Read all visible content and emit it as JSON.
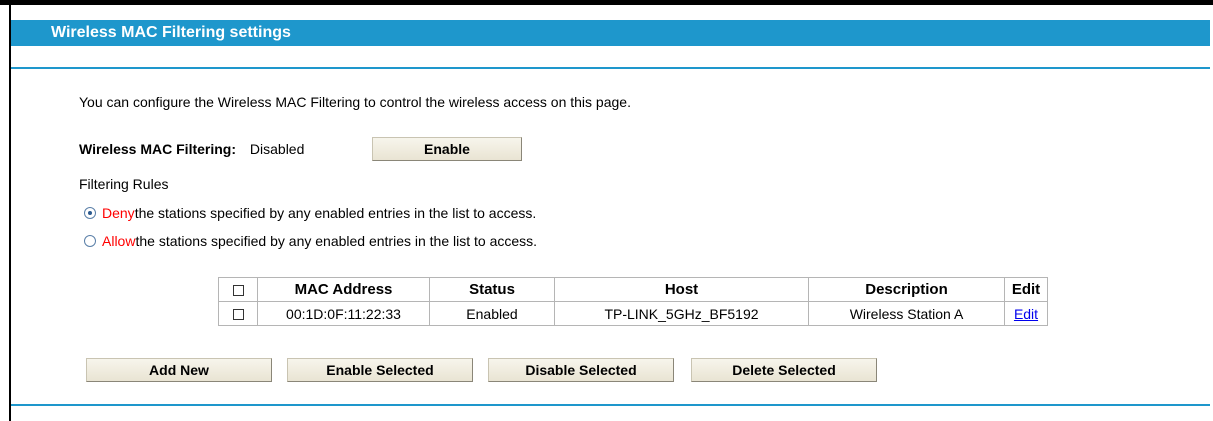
{
  "page": {
    "title": "Wireless MAC Filtering settings",
    "intro": "You can configure the Wireless MAC Filtering to control the wireless access on this page."
  },
  "filtering": {
    "label": "Wireless MAC Filtering:",
    "status": "Disabled",
    "enable_button": "Enable"
  },
  "rules": {
    "title": "Filtering Rules",
    "options": [
      {
        "keyword": "Deny",
        "text": " the stations specified by any enabled entries in the list to access.",
        "selected": true
      },
      {
        "keyword": "Allow",
        "text": " the stations specified by any enabled entries in the list to access.",
        "selected": false
      }
    ]
  },
  "table": {
    "headers": {
      "mac": "MAC Address",
      "status": "Status",
      "host": "Host",
      "description": "Description",
      "edit": "Edit"
    },
    "rows": [
      {
        "mac": "00:1D:0F:11:22:33",
        "status": "Enabled",
        "host": "TP-LINK_5GHz_BF5192",
        "description": "Wireless Station A",
        "edit": "Edit"
      }
    ]
  },
  "actions": {
    "add_new": "Add New",
    "enable_selected": "Enable Selected",
    "disable_selected": "Disable Selected",
    "delete_selected": "Delete Selected"
  },
  "colors": {
    "accent": "#1e97cc",
    "keyword": "#ff0000",
    "link": "#0000ee"
  }
}
